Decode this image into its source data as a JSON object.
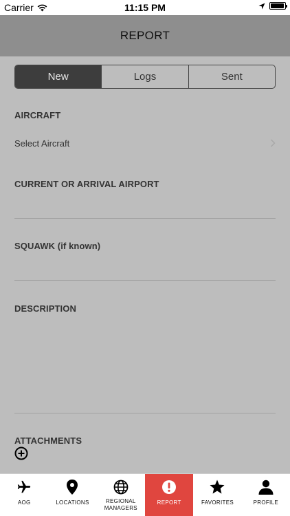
{
  "status_bar": {
    "carrier": "Carrier",
    "time": "11:15 PM",
    "battery_level": 0.95
  },
  "header": {
    "title": "REPORT"
  },
  "segments": [
    {
      "label": "New",
      "active": true
    },
    {
      "label": "Logs",
      "active": false
    },
    {
      "label": "Sent",
      "active": false
    }
  ],
  "form": {
    "aircraft_label": "AIRCRAFT",
    "aircraft_select": "Select Aircraft",
    "airport_label": "CURRENT OR ARRIVAL AIRPORT",
    "airport_value": "",
    "squawk_label": "SQUAWK (if known)",
    "squawk_value": "",
    "description_label": "DESCRIPTION",
    "description_value": "",
    "attachments_label": "ATTACHMENTS"
  },
  "tabs": [
    {
      "label": "AOG",
      "icon": "airplane-icon"
    },
    {
      "label": "LOCATIONS",
      "icon": "location-pin-icon"
    },
    {
      "label": "REGIONAL MANAGERS",
      "icon": "globe-icon"
    },
    {
      "label": "REPORT",
      "icon": "alert-icon",
      "active": true
    },
    {
      "label": "FAVORITES",
      "icon": "star-icon"
    },
    {
      "label": "PROFILE",
      "icon": "person-icon"
    }
  ],
  "colors": {
    "accent": "#e0463f",
    "navbar": "#8e8e8e",
    "background": "#bdbdbd",
    "segment_active": "#3d3d3d"
  }
}
